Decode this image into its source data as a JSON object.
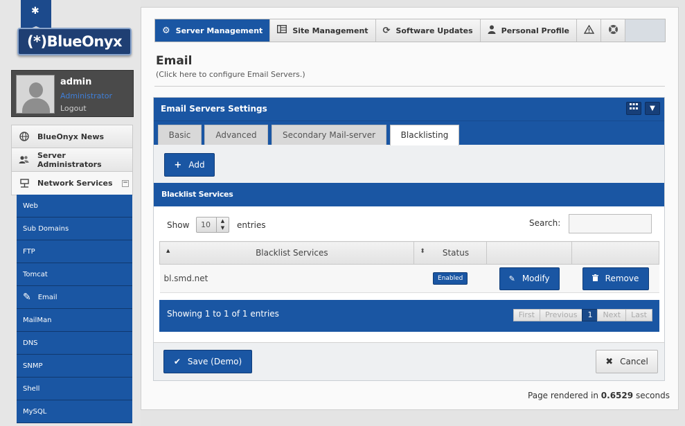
{
  "brand": {
    "logo_text": "(*)BlueOnyx"
  },
  "user": {
    "name": "admin",
    "role": "Administrator",
    "logout": "Logout"
  },
  "sidebar": {
    "menu": [
      {
        "label": "BlueOnyx News",
        "icon": "globe-icon"
      },
      {
        "label": "Server Administrators",
        "icon": "users-icon"
      },
      {
        "label": "Network Services",
        "icon": "network-icon"
      }
    ],
    "submenu": [
      "Web",
      "Sub Domains",
      "FTP",
      "Tomcat",
      "Email",
      "MailMan",
      "DNS",
      "SNMP",
      "Shell",
      "MySQL"
    ]
  },
  "topnav": {
    "tabs": [
      "Server Management",
      "Site Management",
      "Software Updates",
      "Personal Profile"
    ],
    "active": "Server Management"
  },
  "page": {
    "title": "Email",
    "subtitle": "(Click here to configure Email Servers.)"
  },
  "panel": {
    "title": "Email Servers Settings",
    "tabs": [
      "Basic",
      "Advanced",
      "Secondary Mail-server",
      "Blacklisting"
    ],
    "active_tab": "Blacklisting",
    "add_label": "Add"
  },
  "blacklist": {
    "header": "Blacklist Services",
    "show_label": "Show",
    "page_length": "10",
    "entries_label": "entries",
    "search_label": "Search:",
    "search_value": "",
    "columns": [
      "Blacklist Services",
      "Status"
    ],
    "rows": [
      {
        "service": "bl.smd.net",
        "status": "Enabled",
        "modify": "Modify",
        "remove": "Remove"
      }
    ],
    "info": "Showing 1 to 1 of 1 entries",
    "pager": [
      "First",
      "Previous",
      "1",
      "Next",
      "Last"
    ]
  },
  "buttons": {
    "save": "Save (Demo)",
    "cancel": "Cancel"
  },
  "footer": {
    "prefix": "Page rendered in",
    "time": "0.6529",
    "suffix": "seconds"
  },
  "colors": {
    "primary": "#1a56a3",
    "sidebar_bg": "#e6e6e6",
    "userbox_bg": "#4a4a4a"
  }
}
